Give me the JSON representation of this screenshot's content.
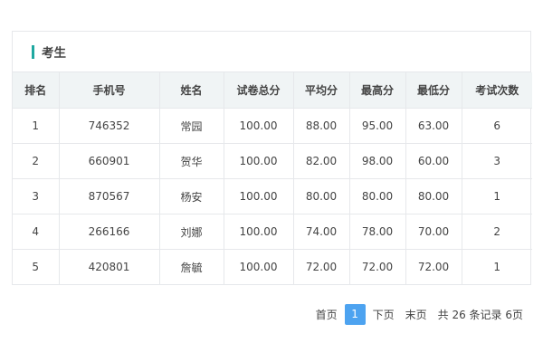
{
  "panel": {
    "title": "考生"
  },
  "table": {
    "columns": [
      "排名",
      "手机号",
      "姓名",
      "试卷总分",
      "平均分",
      "最高分",
      "最低分",
      "考试次数"
    ],
    "rows": [
      [
        "1",
        "746352",
        "常园",
        "100.00",
        "88.00",
        "95.00",
        "63.00",
        "6"
      ],
      [
        "2",
        "660901",
        "贺华",
        "100.00",
        "82.00",
        "98.00",
        "60.00",
        "3"
      ],
      [
        "3",
        "870567",
        "杨安",
        "100.00",
        "80.00",
        "80.00",
        "80.00",
        "1"
      ],
      [
        "4",
        "266166",
        "刘娜",
        "100.00",
        "74.00",
        "78.00",
        "70.00",
        "2"
      ],
      [
        "5",
        "420801",
        "詹毓",
        "100.00",
        "72.00",
        "72.00",
        "72.00",
        "1"
      ]
    ]
  },
  "pager": {
    "first": "首页",
    "current": "1",
    "next": "下页",
    "last": "末页",
    "summary": "共 26 条记录 6页"
  },
  "colors": {
    "accent": "#1fa8a0",
    "current_page": "#4da3f0",
    "header_bg": "#f0f4f5"
  }
}
